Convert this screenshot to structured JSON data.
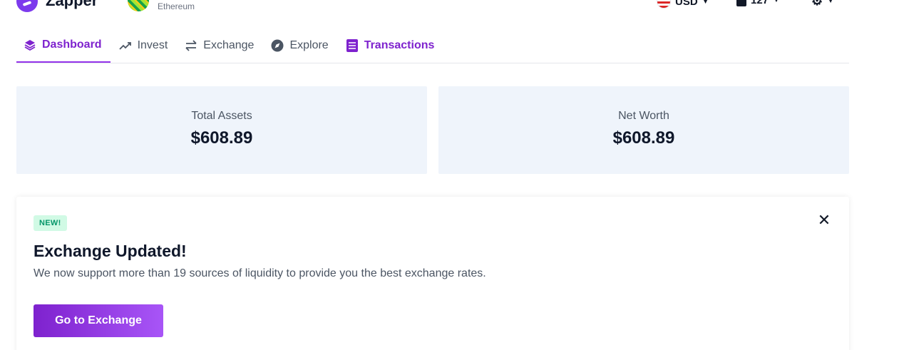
{
  "header": {
    "app_name": "Zapper",
    "wallet_network": "Ethereum",
    "currency": "USD",
    "gas_price": "127"
  },
  "nav": {
    "tabs": [
      {
        "label": "Dashboard",
        "icon": "layers-icon"
      },
      {
        "label": "Invest",
        "icon": "trending-up-icon"
      },
      {
        "label": "Exchange",
        "icon": "swap-arrows-icon"
      },
      {
        "label": "Explore",
        "icon": "compass-icon"
      },
      {
        "label": "Transactions",
        "icon": "list-icon"
      }
    ],
    "active": "Dashboard"
  },
  "summary": {
    "total_assets_label": "Total Assets",
    "total_assets_value": "$608.89",
    "net_worth_label": "Net Worth",
    "net_worth_value": "$608.89"
  },
  "notice": {
    "badge": "NEW!",
    "title": "Exchange Updated!",
    "description": "We now support more than 19 sources of liquidity to provide you the best exchange rates.",
    "button_label": "Go to Exchange"
  },
  "colors": {
    "accent": "#7e22ce",
    "card_bg": "#eff4fb",
    "badge_bg": "#d1fae5",
    "badge_text": "#059669"
  }
}
